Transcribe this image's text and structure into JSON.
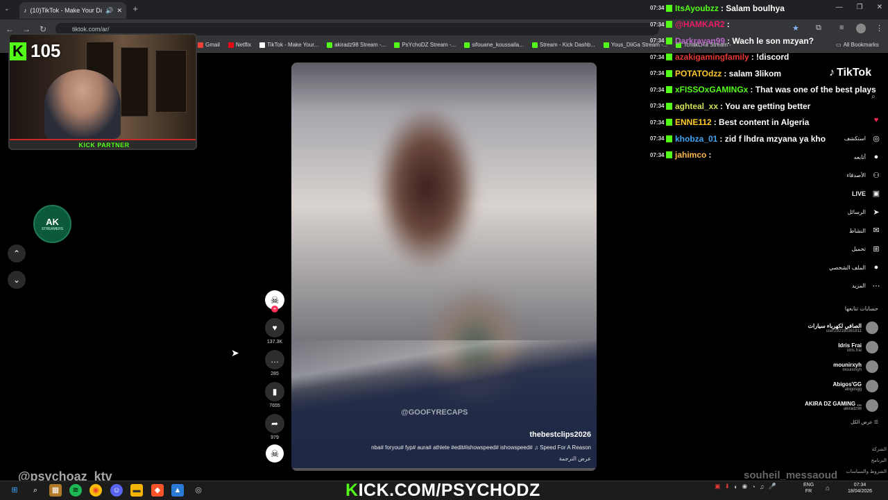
{
  "browser": {
    "tab_title": "(10)TikTok - Make Your Day",
    "url": "tiktok.com/ar/",
    "bookmarks": [
      {
        "label": "Gmail",
        "color": "#ea4335"
      },
      {
        "label": "Netflix",
        "color": "#e50914"
      },
      {
        "label": "TikTok - Make Your...",
        "color": "#ffffff"
      },
      {
        "label": "akiradz98 Stream -...",
        "color": "#53fc18"
      },
      {
        "label": "PsYchoDZ Stream -...",
        "color": "#53fc18"
      },
      {
        "label": "sifouane_koussaila...",
        "color": "#53fc18"
      },
      {
        "label": "Stream - Kick Dashb...",
        "color": "#53fc18"
      },
      {
        "label": "Yous_DiiGa Stream -...",
        "color": "#53fc18"
      },
      {
        "label": "TchakLiTa Stream -",
        "color": "#53fc18"
      }
    ],
    "all_bookmarks": "All Bookmarks"
  },
  "stream": {
    "viewer_count": "105",
    "kick_partner": "KICK PARTNER",
    "handle_left": "@psychoaz_ktv",
    "handle_right": "souheil_messaoud",
    "banner_prefix": "K",
    "banner_text": "ICK.COM/PSYCHODZ"
  },
  "left_logo": {
    "title": "AK",
    "subtitle": "STREAMERS"
  },
  "chat": [
    {
      "time": "07:34",
      "user": "ItsAyoubzz",
      "color": "#53fc18",
      "text": ": Salam boulhya"
    },
    {
      "time": "07:34",
      "user": "@HAMKAR2",
      "color": "#e91e63",
      "text": ":"
    },
    {
      "time": "07:34",
      "user": "Darkrayan99",
      "color": "#ba68c8",
      "text": ": Wach le son mzyan?"
    },
    {
      "time": "07:34",
      "user": "azakigamingfamily",
      "color": "#e53935",
      "text": ": !discord"
    },
    {
      "time": "07:34",
      "user": "POTATOdzz",
      "color": "#ffca28",
      "text": ": salam 3likom"
    },
    {
      "time": "07:34",
      "user": "xFISSOxGAMINGx",
      "color": "#53fc18",
      "text": ": That was one of the best plays"
    },
    {
      "time": "07:34",
      "user": "aghteal_xx",
      "color": "#d4e157",
      "text": ": You are getting better"
    },
    {
      "time": "07:34",
      "user": "ENNE112",
      "color": "#ffca28",
      "text": ": Best content in Algeria"
    },
    {
      "time": "07:34",
      "user": "khobza_01",
      "color": "#42a5f5",
      "text": ": zid f lhdra mzyana ya kho"
    },
    {
      "time": "07:34",
      "user": "jahimco",
      "color": "#ffb74d",
      "text": ":"
    }
  ],
  "video": {
    "watermark": "@GOOFYRECAPS",
    "author": "thebestclips2026",
    "caption": "nba# foryou# fyp# aura# athlete #edit#ishowspeed# ishowspeed# ♫ Speed For A Reason",
    "translate": "عرض الترجمة",
    "progress": 0.0
  },
  "rail": {
    "likes": "137.3K",
    "comments": "285",
    "saves": "7655",
    "shares": "979"
  },
  "tiktok": {
    "logo": "TikTok",
    "nav": [
      {
        "label": "",
        "icon": "♥"
      },
      {
        "label": "استكشف",
        "icon": "◎"
      },
      {
        "label": "أتابعه",
        "icon": "●"
      },
      {
        "label": "الأصدقاء",
        "icon": "⚇"
      },
      {
        "label": "LIVE",
        "icon": "▣"
      },
      {
        "label": "الرسائل",
        "icon": "➤"
      },
      {
        "label": "النشاط",
        "icon": "✉"
      },
      {
        "label": "تحميل",
        "icon": "⊞"
      },
      {
        "label": "الملف الشخصي",
        "icon": "●"
      },
      {
        "label": "المزيد",
        "icon": "⋯"
      }
    ],
    "following_title": "حسابات تتابعها",
    "following": [
      {
        "name": "الصافي لكهرباء سيارات",
        "handle": "user292180361811"
      },
      {
        "name": "Idris Frai",
        "handle": "idris.frai"
      },
      {
        "name": "mounirxyh",
        "handle": "mounirxyh"
      },
      {
        "name": "Abigos'GG",
        "handle": "abigosgg"
      },
      {
        "name": "AKIRA DZ GAMING ...",
        "handle": "akiradz98"
      }
    ],
    "see_all": "عرض الكل",
    "footer": [
      "الشركة",
      "البرنامج",
      "الشروط والسياسات"
    ]
  },
  "taskbar": {
    "lang_top": "ENG",
    "lang_bottom": "FR",
    "time": "07:34",
    "date": "18/04/2026"
  }
}
